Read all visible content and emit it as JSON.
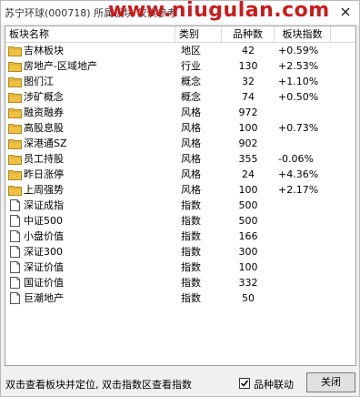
{
  "window": {
    "title": "苏宁环球(000718)  所属板块 仅供参考",
    "watermark": "www.niugulan.com"
  },
  "columns": {
    "name": "板块名称",
    "type": "类别",
    "count": "品种数",
    "index": "板块指数"
  },
  "rows": [
    {
      "icon": "folder-icon",
      "name": "吉林板块",
      "type": "地区",
      "count": "42",
      "change": "+0.59%"
    },
    {
      "icon": "folder-icon",
      "name": "房地产-区域地产",
      "type": "行业",
      "count": "130",
      "change": "+2.53%"
    },
    {
      "icon": "folder-icon",
      "name": "图们江",
      "type": "概念",
      "count": "32",
      "change": "+1.10%"
    },
    {
      "icon": "folder-icon",
      "name": "涉矿概念",
      "type": "概念",
      "count": "74",
      "change": "+0.50%"
    },
    {
      "icon": "folder-icon",
      "name": "融资融券",
      "type": "风格",
      "count": "972",
      "change": ""
    },
    {
      "icon": "folder-icon",
      "name": "高股息股",
      "type": "风格",
      "count": "100",
      "change": "+0.73%"
    },
    {
      "icon": "folder-icon",
      "name": "深港通SZ",
      "type": "风格",
      "count": "902",
      "change": ""
    },
    {
      "icon": "folder-icon",
      "name": "员工持股",
      "type": "风格",
      "count": "355",
      "change": "-0.06%"
    },
    {
      "icon": "folder-icon",
      "name": "昨日涨停",
      "type": "风格",
      "count": "24",
      "change": "+4.36%"
    },
    {
      "icon": "folder-icon",
      "name": "上周强势",
      "type": "风格",
      "count": "100",
      "change": "+2.17%"
    },
    {
      "icon": "document-icon",
      "name": "深证成指",
      "type": "指数",
      "count": "500",
      "change": ""
    },
    {
      "icon": "document-icon",
      "name": "中证500",
      "type": "指数",
      "count": "500",
      "change": ""
    },
    {
      "icon": "document-icon",
      "name": "小盘价值",
      "type": "指数",
      "count": "166",
      "change": ""
    },
    {
      "icon": "document-icon",
      "name": "深证300",
      "type": "指数",
      "count": "300",
      "change": ""
    },
    {
      "icon": "document-icon",
      "name": "深证价值",
      "type": "指数",
      "count": "100",
      "change": ""
    },
    {
      "icon": "document-icon",
      "name": "国证价值",
      "type": "指数",
      "count": "332",
      "change": ""
    },
    {
      "icon": "document-icon",
      "name": "巨潮地产",
      "type": "指数",
      "count": "50",
      "change": ""
    }
  ],
  "status": {
    "hint": "双击查看板块并定位, 双击指数区查看指数",
    "checkbox_label": "品种联动",
    "checkbox_checked": true,
    "close_label": "关闭"
  },
  "colors": {
    "folder": "#f0c040",
    "watermark": "#cc1a1a"
  }
}
